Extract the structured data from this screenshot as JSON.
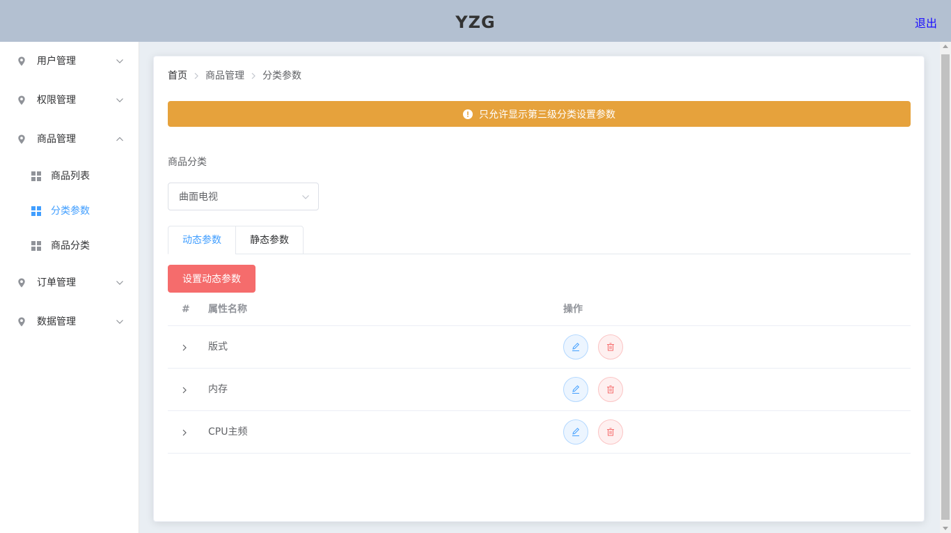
{
  "header": {
    "title": "YZG",
    "logout_label": "退出"
  },
  "sidebar": {
    "items": [
      {
        "label": "用户管理",
        "expanded": false
      },
      {
        "label": "权限管理",
        "expanded": false
      },
      {
        "label": "商品管理",
        "expanded": true
      },
      {
        "label": "订单管理",
        "expanded": false
      },
      {
        "label": "数据管理",
        "expanded": false
      }
    ],
    "sub_items": [
      {
        "label": "商品列表",
        "active": false
      },
      {
        "label": "分类参数",
        "active": true
      },
      {
        "label": "商品分类",
        "active": false
      }
    ]
  },
  "breadcrumb": [
    "首页",
    "商品管理",
    "分类参数"
  ],
  "alert": {
    "text": "只允许显示第三级分类设置参数",
    "color": "#e6a23c"
  },
  "category": {
    "label": "商品分类",
    "selected": "曲面电视"
  },
  "tabs": [
    {
      "label": "动态参数",
      "active": true
    },
    {
      "label": "静态参数",
      "active": false
    }
  ],
  "set_button_label": "设置动态参数",
  "table": {
    "headers": {
      "index": "#",
      "name": "属性名称",
      "ops": "操作"
    },
    "rows": [
      {
        "name": "版式"
      },
      {
        "name": "内存"
      },
      {
        "name": "CPU主频"
      }
    ]
  },
  "colors": {
    "primary": "#409eff",
    "danger": "#f56c6c",
    "warning": "#e6a23c",
    "header_bg": "#b3c0d1"
  }
}
